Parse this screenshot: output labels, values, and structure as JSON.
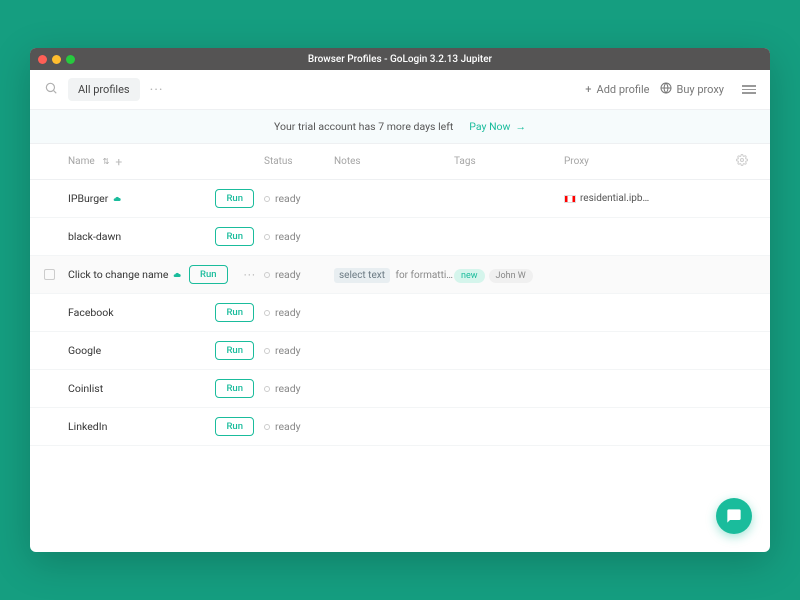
{
  "window_title": "Browser Profiles - GoLogin 3.2.13 Jupiter",
  "toolbar": {
    "filter_chip": "All profiles",
    "add_profile": "Add profile",
    "buy_proxy": "Buy proxy"
  },
  "banner": {
    "message": "Your trial account has 7 more days left",
    "pay_now": "Pay Now"
  },
  "columns": {
    "name": "Name",
    "status": "Status",
    "notes": "Notes",
    "tags": "Tags",
    "proxy": "Proxy"
  },
  "run_label": "Run",
  "ready_label": "ready",
  "profiles": [
    {
      "name": "IPBurger",
      "cloud": true,
      "status": "ready",
      "proxy": "residential.ipb…",
      "flag": "ca"
    },
    {
      "name": "black-dawn",
      "status": "ready"
    },
    {
      "name": "Click to change name",
      "cloud": true,
      "status": "ready",
      "selected": true,
      "more": true,
      "notes_highlight": "select text",
      "notes_rest": " for formatti…",
      "tags": [
        "new",
        "John W"
      ]
    },
    {
      "name": "Facebook",
      "status": "ready"
    },
    {
      "name": "Google",
      "status": "ready"
    },
    {
      "name": "Coinlist",
      "status": "ready"
    },
    {
      "name": "LinkedIn",
      "status": "ready"
    }
  ]
}
